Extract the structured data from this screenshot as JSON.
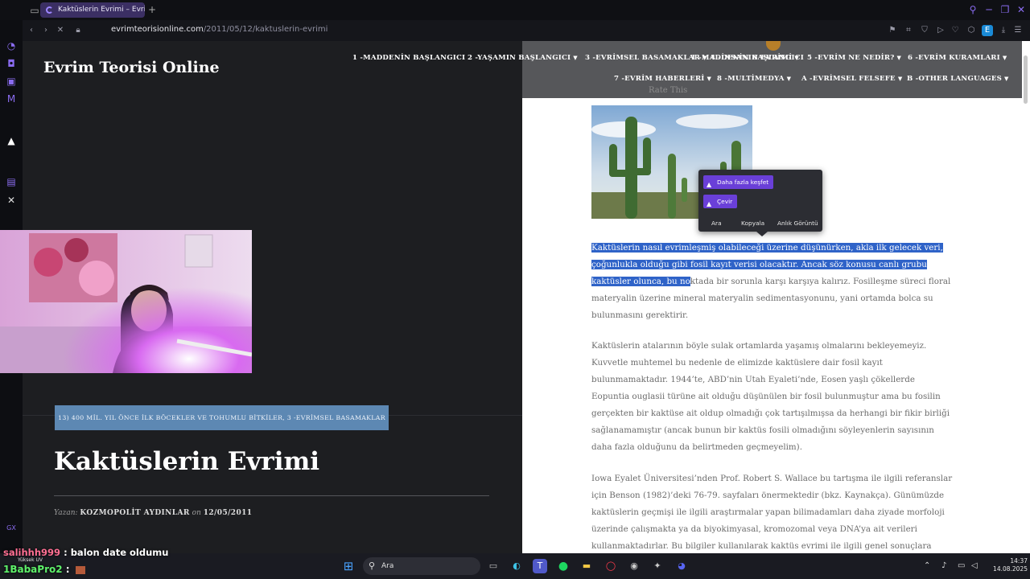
{
  "browser": {
    "tab_title": "Kaktüslerin Evrimi – Evrim",
    "new_tab": "+",
    "url_domain": "evrimteorisionline.com",
    "url_path": "/2011/05/12/kaktuslerin-evrimi",
    "profile_initial": "E",
    "accent": "#8a6cf0"
  },
  "site": {
    "title": "Evrim Teorisi Online",
    "nav": [
      {
        "label": "1 -MADDENİN BAŞLANGICI",
        "dropdown": false
      },
      {
        "label": "2 -YAŞAMIN BAŞLANGICI",
        "dropdown": true
      },
      {
        "label": "3 -EVRİMSEL BASAMAKLAR",
        "dropdown": true
      },
      {
        "label": "4 -İNSANIN EVRİMİ",
        "dropdown": true
      },
      {
        "label": "5 -EVRİM NE NEDİR?",
        "dropdown": true
      },
      {
        "label": "6 -EVRİM KURAMLARI",
        "dropdown": true
      },
      {
        "label": "7 -EVRİM HABERLERİ",
        "dropdown": true
      },
      {
        "label": "8 -MULTİMEDYA",
        "dropdown": true
      },
      {
        "label": "A -EVRİMSEL FELSEFE",
        "dropdown": true
      },
      {
        "label": "B -OTHER LANGUAGES",
        "dropdown": true
      }
    ],
    "caret": "▼"
  },
  "post": {
    "categories": "13) 400 MİL. YIL ÖNCE İLK BÖCEKLER VE TOHUMLU BİTKİLER, 3 -EVRİMSEL BASAMAKLAR",
    "title": "Kaktüslerin Evrimi",
    "byline_prefix": "Yazan:",
    "author": "KOZMOPOLİT AYDINLAR",
    "byline_on": "on",
    "date": "12/05/2011",
    "rate_label": "Rate This"
  },
  "article": {
    "p1_highlighted": "Kaktüslerin nasıl evrimleşmiş olabileceği üzerine düşünürken, akla ilk gelecek veri, çoğunlukla olduğu gibi fosil kayıt verisi olacaktır. Ancak söz konusu canlı grubu kaktüsler olunca, bu no",
    "p1_rest": "ktada bir sorunla karşı karşıya kalırız. Fosilleşme süreci floral materyalin üzerine mineral materyalin sedimentasyonunu, yani ortamda bolca su bulunmasını gerektirir.",
    "p2": "Kaktüslerin atalarının böyle sulak ortamlarda yaşamış olmalarını bekleyemeyiz. Kuvvetle muhtemel bu nedenle de elimizde kaktüslere dair fosil kayıt bulunmamaktadır. 1944’te, ABD’nin Utah Eyaleti’nde, Eosen yaşlı çökellerde Eopuntia ouglasii türüne ait olduğu düşünülen bir fosil bulunmuştur ama bu fosilin gerçekten bir kaktüse ait oldup olmadığı çok tartışılmışsa da herhangi bir fikir birliği sağlanamamıştır (ancak bunun bir kaktüs fosili olmadığını söyleyenlerin sayısının daha fazla olduğunu da belirtmeden geçmeyelim).",
    "p3": "Iowa Eyalet Üniversitesi’nden Prof. Robert S. Wallace bu tartışma ile ilgili referanslar için Benson (1982)’deki 76-79. sayfaları önermektedir (bkz. Kaynakça). Günümüzde kaktüslerin geçmişi ile ilgili araştırmalar yapan bilimadamları daha ziyade morfoloji üzerinde çalışmakta ya da biyokimyasal, kromozomal veya DNA’ya ait verileri kullanmaktadırlar. Bu bilgiler kullanılarak kaktüs evrimi ile ilgili genel sonuçlara"
  },
  "popup": {
    "explore": "Daha fazla keşfet",
    "translate": "Çevir",
    "actions": [
      "Ara",
      "Kopyala",
      "Anlık Görüntü"
    ],
    "color": "#6a3fd8"
  },
  "stream": {
    "chat": [
      {
        "user": "salihhh999",
        "sep": ":",
        "message": "balon date oldumu"
      },
      {
        "user": "1BabaPro2",
        "sep": ":",
        "message": ""
      }
    ],
    "quality": "Yüksek UV"
  },
  "taskbar": {
    "search_placeholder": "Ara",
    "time": "14:37",
    "date": "14.08.2025"
  }
}
